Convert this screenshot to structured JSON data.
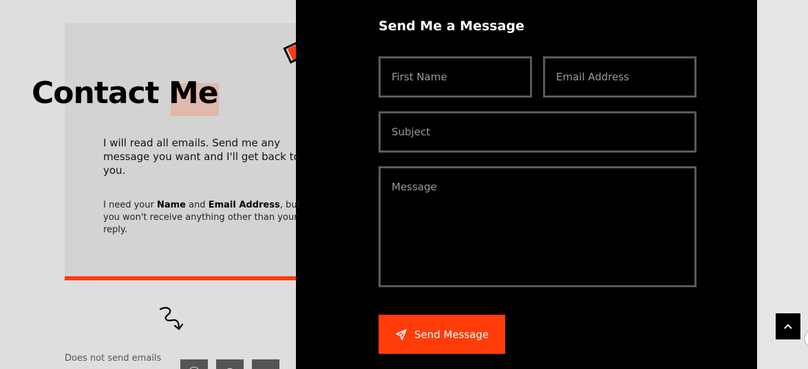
{
  "left": {
    "title": "Contact Me",
    "intro": "I will read all emails. Send me any message you want and I'll get back to you.",
    "note_prefix": "I need your ",
    "note_name": "Name",
    "note_and": " and ",
    "note_email": "Email Address",
    "note_suffix": ", but you won't receive anything other than your reply.",
    "no_send_text": "Does not send emails"
  },
  "form": {
    "heading": "Send Me a Message",
    "first_name_placeholder": "First Name",
    "email_placeholder": "Email Address",
    "subject_placeholder": "Subject",
    "message_placeholder": "Message",
    "send_label": "Send Message"
  },
  "colors": {
    "accent": "#ff3c0a",
    "panel": "#000000",
    "card": "#d3d3d3"
  },
  "icons": [
    "diamond-deco-icon",
    "curly-arrow-icon",
    "send-icon",
    "chevron-up-icon"
  ]
}
